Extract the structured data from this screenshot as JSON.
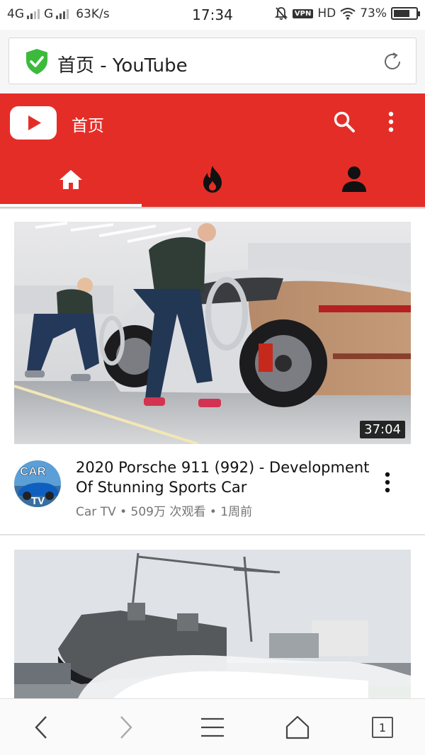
{
  "status_bar": {
    "network_1": "4G",
    "network_2": "G",
    "speed": "63K/s",
    "time": "17:34",
    "vpn": "VPN",
    "hd": "HD",
    "battery": "73%",
    "battery_level": 0.73
  },
  "address_bar": {
    "page_title": "首页 - YouTube",
    "secure_icon": "shield-check-icon",
    "reload_icon": "reload-icon"
  },
  "youtube": {
    "header_title": "首页",
    "brand_color": "#e52d27",
    "icons": [
      "youtube-logo-icon",
      "search-icon",
      "more-vert-icon"
    ],
    "tabs": [
      {
        "name": "home",
        "icon": "home-icon",
        "selected": true
      },
      {
        "name": "trending",
        "icon": "fire-icon",
        "selected": false
      },
      {
        "name": "account",
        "icon": "account-icon",
        "selected": false
      }
    ]
  },
  "videos": [
    {
      "title": "2020 Porsche 911 (992) - Development Of Stunning Sports Car",
      "duration": "37:04",
      "channel": "Car TV",
      "views": "509万 次观看",
      "age": "1周前",
      "meta_separator": "•",
      "avatar_text_top": "CAR",
      "avatar_text_bottom": "TV"
    },
    {
      "thumbnail": "ship-launch"
    }
  ],
  "bottom_bar": {
    "icons": [
      "back-icon",
      "forward-icon",
      "menu-icon",
      "home-icon",
      "tabs-icon"
    ],
    "tab_count": "1"
  }
}
